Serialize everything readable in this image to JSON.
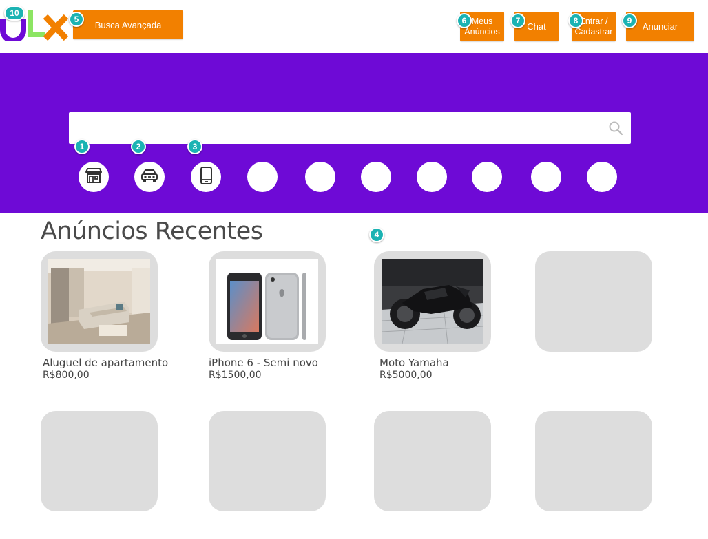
{
  "header": {
    "logo_text": "OLX",
    "buttons": {
      "busca_avancada": "Busca Avançada",
      "meus_anuncios": "Meus Anúncios",
      "chat": "Chat",
      "entrar": "Entrar / Cadastrar",
      "anunciar": "Anunciar"
    }
  },
  "search": {
    "value": "",
    "icon": "search-icon"
  },
  "categories": [
    {
      "name": "imoveis",
      "icon": "store-icon"
    },
    {
      "name": "veiculos",
      "icon": "car-icon"
    },
    {
      "name": "celulares",
      "icon": "smartphone-icon"
    },
    {
      "name": "",
      "icon": ""
    },
    {
      "name": "",
      "icon": ""
    },
    {
      "name": "",
      "icon": ""
    },
    {
      "name": "",
      "icon": ""
    },
    {
      "name": "",
      "icon": ""
    },
    {
      "name": "",
      "icon": ""
    },
    {
      "name": "",
      "icon": ""
    }
  ],
  "recent": {
    "title": "Anúncios Recentes",
    "listings": [
      {
        "title": "Aluguel de apartamento",
        "price": "R$800,00",
        "image": "apartment-photo"
      },
      {
        "title": "iPhone 6 - Semi novo",
        "price": "R$1500,00",
        "image": "iphone-photo"
      },
      {
        "title": "Moto Yamaha",
        "price": "R$5000,00",
        "image": "motorcycle-photo"
      }
    ]
  },
  "annotations": [
    "1",
    "2",
    "3",
    "4",
    "5",
    "6",
    "7",
    "8",
    "9",
    "10"
  ],
  "colors": {
    "brand_purple": "#6e0ad6",
    "accent_orange": "#f28000",
    "badge_teal": "#1bb3b3",
    "placeholder_gray": "#dddddd"
  }
}
